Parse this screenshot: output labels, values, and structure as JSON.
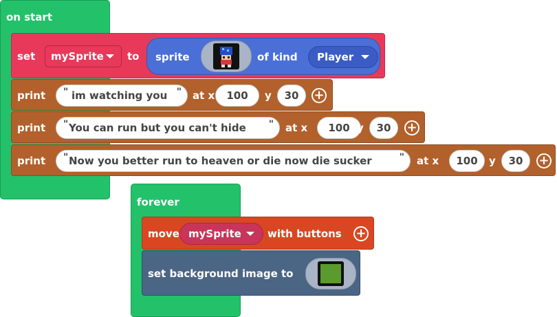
{
  "on_start": {
    "label": "on start",
    "set_block": {
      "set_label": "set",
      "variable": "mySprite",
      "to_label": "to",
      "sprite_label": "sprite",
      "of_kind_label": "of kind",
      "kind": "Player"
    },
    "prints": [
      {
        "label": "print",
        "text": "im watching you",
        "at_x_label": "at x",
        "x": "100",
        "y_label": "y",
        "y": "30"
      },
      {
        "label": "print",
        "text": "You can run but you can't hide",
        "at_x_label": "at x",
        "x": "100",
        "y_label": "y",
        "y": "30"
      },
      {
        "label": "print",
        "text": "Now you better run to heaven or die now die sucker",
        "at_x_label": "at x",
        "x": "100",
        "y_label": "y",
        "y": "30"
      }
    ]
  },
  "forever": {
    "label": "forever",
    "move_block": {
      "move_label": "move",
      "variable": "mySprite",
      "with_label": "with buttons"
    },
    "bg_block": {
      "label": "set background image to"
    }
  },
  "quote_mark": "\"",
  "plus_glyph": "+",
  "colors": {
    "event": "#23c16a",
    "sprites": "#e8395a",
    "text": "#b2612c",
    "controller": "#d94722",
    "scene": "#4b6584",
    "sprite_value": "#4a6fd6"
  },
  "icons": [
    "plus-circle-icon",
    "dropdown-caret-icon",
    "sprite-image-icon",
    "background-image-icon"
  ]
}
